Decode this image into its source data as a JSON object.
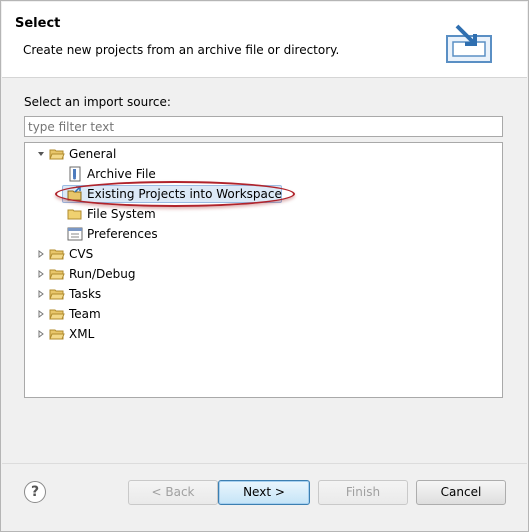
{
  "header": {
    "title": "Select",
    "description": "Create new projects from an archive file or directory."
  },
  "source": {
    "label": "Select an import source:",
    "filter_placeholder": "type filter text"
  },
  "tree": {
    "items": [
      {
        "label": "General",
        "expanded": true,
        "icon": "folder-open-icon"
      },
      {
        "label": "Archive File",
        "icon": "archive-file-icon"
      },
      {
        "label": "Existing Projects into Workspace",
        "icon": "existing-projects-icon",
        "selected": true,
        "highlighted": true
      },
      {
        "label": "File System",
        "icon": "folder-icon"
      },
      {
        "label": "Preferences",
        "icon": "preferences-icon"
      },
      {
        "label": "CVS",
        "expanded": false,
        "icon": "folder-icon"
      },
      {
        "label": "Run/Debug",
        "expanded": false,
        "icon": "folder-icon"
      },
      {
        "label": "Tasks",
        "expanded": false,
        "icon": "folder-icon"
      },
      {
        "label": "Team",
        "expanded": false,
        "icon": "folder-icon"
      },
      {
        "label": "XML",
        "expanded": false,
        "icon": "folder-icon"
      }
    ]
  },
  "buttons": {
    "help": "?",
    "back": "< Back",
    "next": "Next >",
    "finish": "Finish",
    "cancel": "Cancel"
  },
  "colors": {
    "selection": "#dce9f7",
    "highlight_ellipse": "#b0232b",
    "folder": "#e8c66a"
  }
}
